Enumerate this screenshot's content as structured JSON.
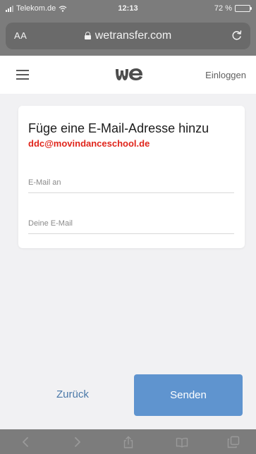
{
  "status_bar": {
    "carrier": "Telekom.de",
    "time": "12:13",
    "battery": "72 %",
    "battery_level": 0.72
  },
  "address_bar": {
    "text_size_button": "AA",
    "url": "wetransfer.com"
  },
  "header": {
    "login": "Einloggen",
    "logo_text": "we"
  },
  "form": {
    "title": "Füge eine E-Mail-Adresse hinzu",
    "recipient": "ddc@movindanceschool.de",
    "to_placeholder": "E-Mail an",
    "from_placeholder": "Deine E-Mail"
  },
  "actions": {
    "back": "Zurück",
    "send": "Senden"
  },
  "colors": {
    "accent": "#5f94cf",
    "link": "#4a78a8",
    "recipient": "#e0251b",
    "chrome": "#7c7c7c",
    "battery": "#f5d84a"
  },
  "toolbar": {
    "icons": [
      "back-icon",
      "forward-icon",
      "share-icon",
      "bookmarks-icon",
      "tabs-icon"
    ]
  }
}
